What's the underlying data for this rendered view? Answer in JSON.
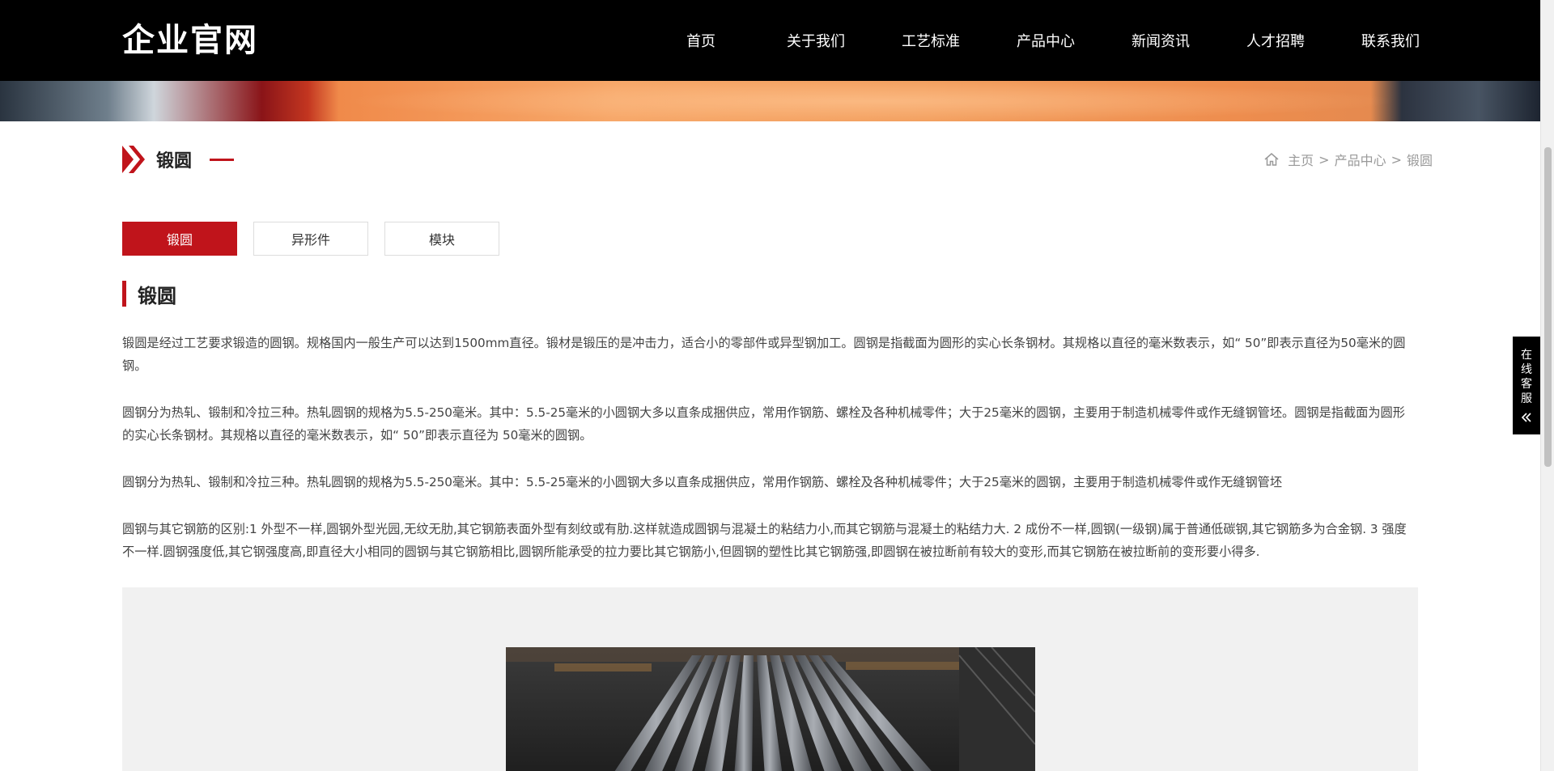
{
  "header": {
    "logo": "企业官网",
    "nav": [
      {
        "label": "首页"
      },
      {
        "label": "关于我们"
      },
      {
        "label": "工艺标准"
      },
      {
        "label": "产品中心"
      },
      {
        "label": "新闻资讯"
      },
      {
        "label": "人才招聘"
      },
      {
        "label": "联系我们"
      }
    ]
  },
  "page": {
    "title": "锻圆",
    "breadcrumb": {
      "home": "主页",
      "sep1": ">",
      "category": "产品中心",
      "sep2": ">",
      "current": "锻圆"
    }
  },
  "tabs": [
    {
      "label": "锻圆",
      "active": true
    },
    {
      "label": "异形件",
      "active": false
    },
    {
      "label": "模块",
      "active": false
    }
  ],
  "article": {
    "heading": "锻圆",
    "paragraphs": [
      "锻圆是经过工艺要求锻造的圆钢。规格国内一般生产可以达到1500mm直径。锻材是锻压的是冲击力，适合小的零部件或异型钢加工。圆钢是指截面为圆形的实心长条钢材。其规格以直径的毫米数表示，如“ 50”即表示直径为50毫米的圆钢。",
      "圆钢分为热轧、锻制和冷拉三种。热轧圆钢的规格为5.5-250毫米。其中：5.5-25毫米的小圆钢大多以直条成捆供应，常用作钢筋、螺栓及各种机械零件；大于25毫米的圆钢，主要用于制造机械零件或作无缝钢管坯。圆钢是指截面为圆形的实心长条钢材。其规格以直径的毫米数表示，如“ 50”即表示直径为 50毫米的圆钢。",
      "圆钢分为热轧、锻制和冷拉三种。热轧圆钢的规格为5.5-250毫米。其中：5.5-25毫米的小圆钢大多以直条成捆供应，常用作钢筋、螺栓及各种机械零件；大于25毫米的圆钢，主要用于制造机械零件或作无缝钢管坯",
      "圆钢与其它钢筋的区别:1 外型不一样,圆钢外型光园,无纹无肋,其它钢筋表面外型有刻纹或有肋.这样就造成圆钢与混凝土的粘结力小,而其它钢筋与混凝土的粘结力大. 2 成份不一样,圆钢(一级钢)属于普通低碳钢,其它钢筋多为合金钢. 3 强度不一样.圆钢强度低,其它钢强度高,即直径大小相同的圆钢与其它钢筋相比,圆钢所能承受的拉力要比其它钢筋小,但圆钢的塑性比其它钢筋强,即圆钢在被拉断前有较大的变形,而其它钢筋在被拉断前的变形要小得多."
    ]
  },
  "service": {
    "label": "在线客服"
  },
  "colors": {
    "accent": "#c0141b",
    "header_bg": "#000000",
    "image_area_bg": "#f1f1f1"
  }
}
